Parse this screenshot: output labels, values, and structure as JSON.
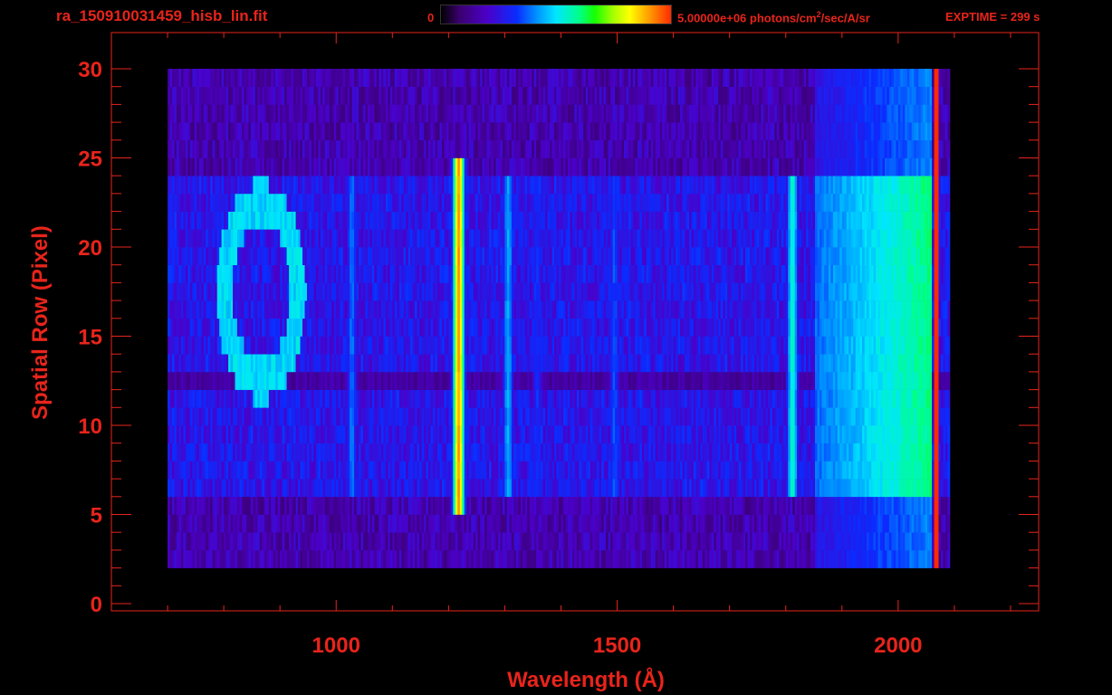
{
  "header": {
    "filename": "ra_150910031459_hisb_lin.fit",
    "colorbar_min": "0",
    "colorbar_max_value": "5.00000e+06 photons/cm",
    "colorbar_max_exp": "2",
    "colorbar_max_unit": "/sec/A/sr",
    "exptime": "EXPTIME = 299 s"
  },
  "colors": {
    "axis": "#e8241b",
    "background": "#000000"
  },
  "chart_data": {
    "type": "heatmap",
    "xlabel": "Wavelength (Å)",
    "ylabel": "Spatial Row (Pixel)",
    "xlim": [
      600,
      2250
    ],
    "ylim": [
      0,
      30
    ],
    "xticks": [
      1000,
      1500,
      2000
    ],
    "yticks": [
      0,
      5,
      10,
      15,
      20,
      25,
      30
    ],
    "x_minor_step": 100,
    "y_minor_step": 1,
    "colorbar": {
      "min": 0,
      "max": 5000000,
      "units": "photons/cm^2/sec/A/sr"
    },
    "coverage": {
      "full_band_rows": [
        6,
        24
      ],
      "faint_band_rows": [
        [
          2,
          6
        ],
        [
          24,
          30
        ]
      ],
      "x_range": [
        700,
        2090
      ],
      "bright_edge_x": 2065
    },
    "emission_features": [
      {
        "x": 1216,
        "rows": [
          5,
          25
        ],
        "level": 0.88
      },
      {
        "x": 1304,
        "rows": [
          6,
          24
        ],
        "level": 0.42
      },
      {
        "x": 1026,
        "rows": [
          6,
          24
        ],
        "level": 0.36
      },
      {
        "x": 1356,
        "rows": [
          6,
          24
        ],
        "level": 0.3
      },
      {
        "x": 1493,
        "rows": [
          6,
          24
        ],
        "level": 0.33
      },
      {
        "x": 1810,
        "rows": [
          6,
          24
        ],
        "level": 0.52
      }
    ],
    "ring_feature": {
      "center_x": 865,
      "center_row": 17.5,
      "radius_x": 65,
      "radius_rows": 5,
      "level": 0.45
    },
    "dark_gap_row": 12.5,
    "continuum": {
      "x_start": 1850,
      "x_end": 2060,
      "level_start": 0.35,
      "level_end": 0.58
    }
  }
}
